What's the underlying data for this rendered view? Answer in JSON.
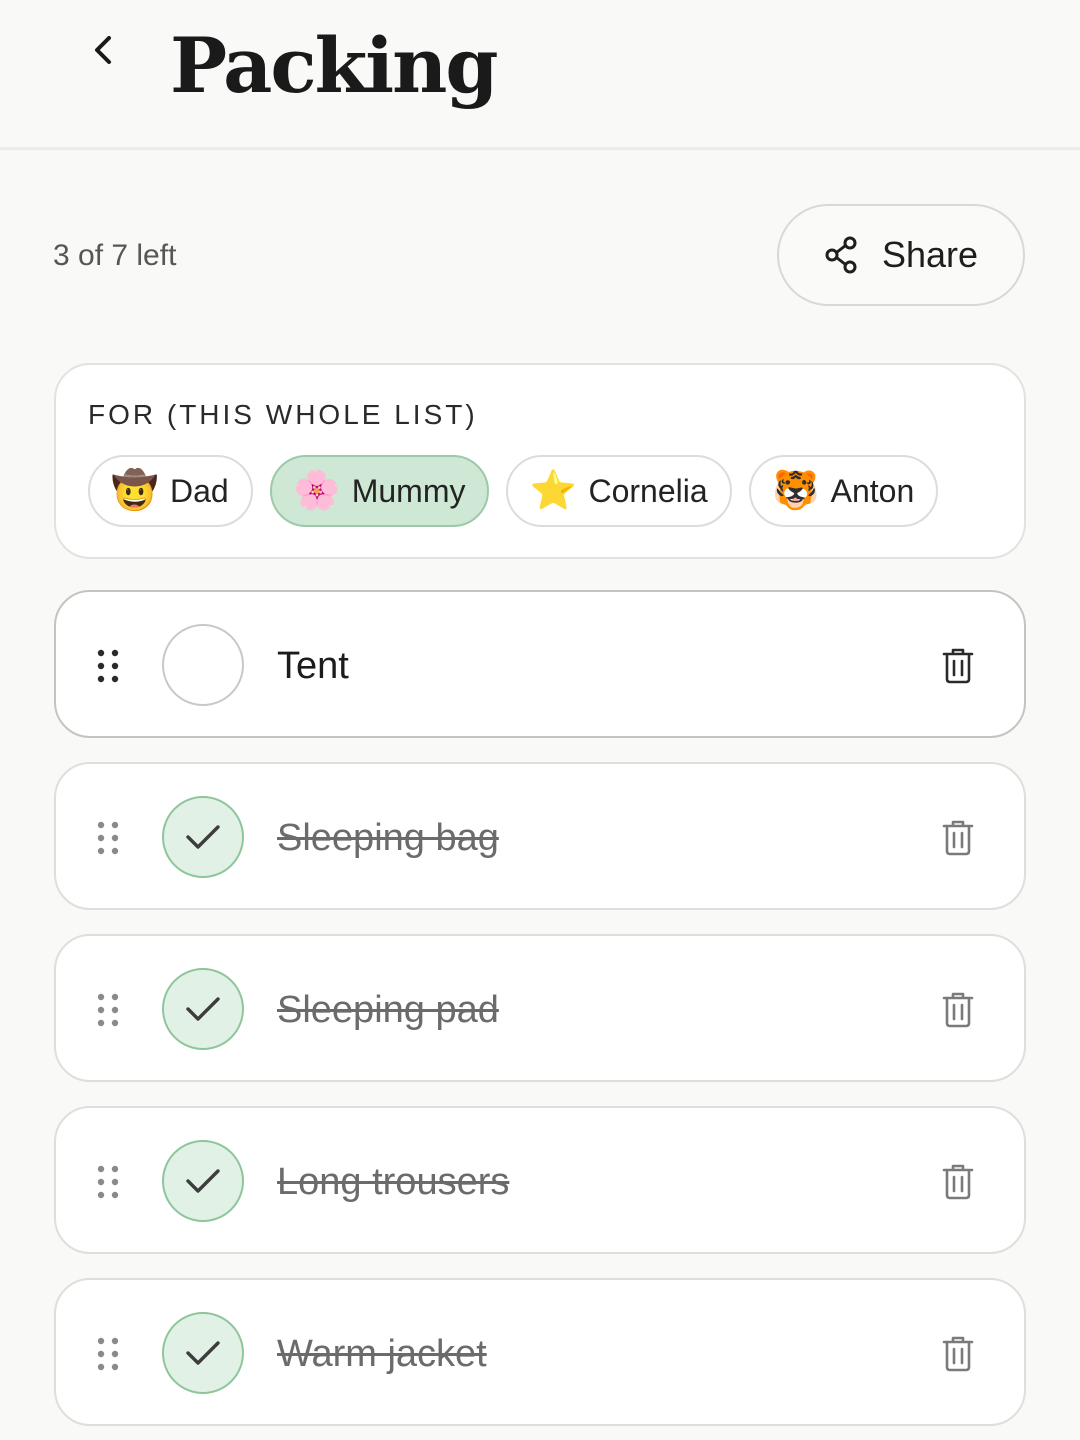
{
  "header": {
    "title": "Packing",
    "back_icon": "chevron-left-icon"
  },
  "summary": {
    "text": "3 of 7 left"
  },
  "share": {
    "label": "Share",
    "icon": "share-icon"
  },
  "for_section": {
    "heading": "FOR (THIS WHOLE LIST)",
    "chips": [
      {
        "emoji": "🤠",
        "name": "Dad",
        "selected": false
      },
      {
        "emoji": "🌸",
        "name": "Mummy",
        "selected": true
      },
      {
        "emoji": "⭐",
        "name": "Cornelia",
        "selected": false
      },
      {
        "emoji": "🐯",
        "name": "Anton",
        "selected": false
      }
    ]
  },
  "items": [
    {
      "label": "Tent",
      "checked": false
    },
    {
      "label": "Sleeping bag",
      "checked": true
    },
    {
      "label": "Sleeping pad",
      "checked": true
    },
    {
      "label": "Long trousers",
      "checked": true
    },
    {
      "label": "Warm jacket",
      "checked": true
    }
  ],
  "colors": {
    "accent_green": "#cfe8d5",
    "check_green": "#e2f1e5",
    "background": "#f9f9f7"
  }
}
